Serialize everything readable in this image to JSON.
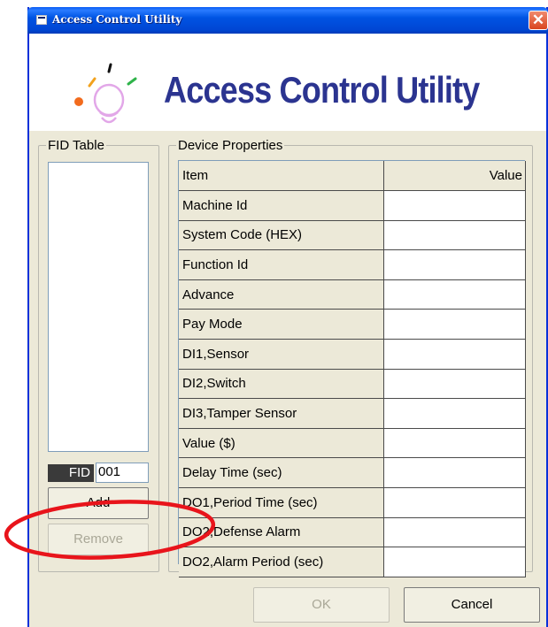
{
  "window": {
    "title": "Access Control Utility",
    "close_glyph": "✕"
  },
  "banner": {
    "text": "Access Control Utility"
  },
  "fid_table": {
    "label": "FID Table",
    "fid_tag": "FID",
    "fid_value": "001",
    "add_label": "Add",
    "remove_label": "Remove"
  },
  "device_properties": {
    "label": "Device Properties",
    "columns": [
      "Item",
      "Value"
    ],
    "rows": [
      {
        "item": "Machine Id",
        "value": ""
      },
      {
        "item": "System Code (HEX)",
        "value": ""
      },
      {
        "item": "Function Id",
        "value": ""
      },
      {
        "item": "Advance",
        "value": ""
      },
      {
        "item": "Pay Mode",
        "value": ""
      },
      {
        "item": "DI1,Sensor",
        "value": ""
      },
      {
        "item": "DI2,Switch",
        "value": ""
      },
      {
        "item": "DI3,Tamper Sensor",
        "value": ""
      },
      {
        "item": "Value ($)",
        "value": ""
      },
      {
        "item": "Delay Time (sec)",
        "value": ""
      },
      {
        "item": "DO1,Period Time (sec)",
        "value": ""
      },
      {
        "item": "DO2,Defense Alarm",
        "value": ""
      },
      {
        "item": "DO2,Alarm Period (sec)",
        "value": ""
      }
    ]
  },
  "footer": {
    "ok_label": "OK",
    "cancel_label": "Cancel"
  },
  "colors": {
    "title_bar": "#0054e3",
    "annotation": "#e8141b",
    "banner_text": "#2b3490"
  }
}
